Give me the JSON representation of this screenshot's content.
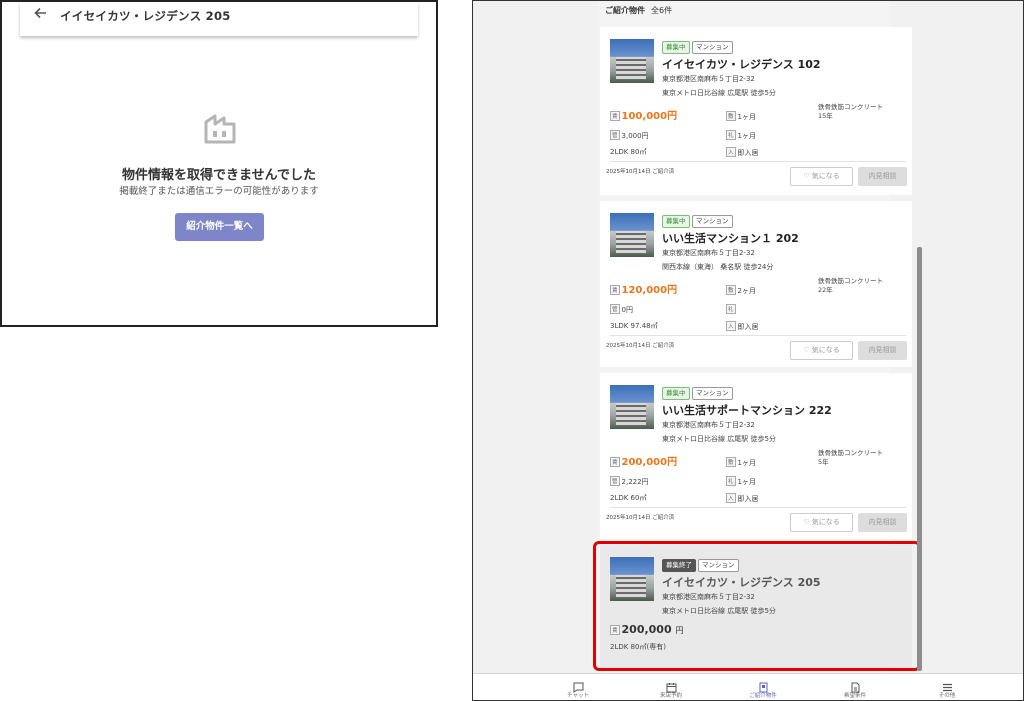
{
  "detail": {
    "title": "イイセイカツ・レジデンス 205",
    "error_title": "物件情報を取得できませんでした",
    "error_sub": "掲載終了または通信エラーの可能性があります",
    "button_label": "紹介物件一覧へ"
  },
  "list": {
    "heading": "ご紹介物件",
    "count": "全6件",
    "cards": [
      {
        "status": "募集中",
        "type": "マンション",
        "title": "イイセイカツ・レジデンス 102",
        "address": "東京都港区南麻布５丁目2-32",
        "station": "東京メトロ日比谷線 広尾駅 徒歩5分",
        "rent_tag": "賃",
        "rent": "100,000円",
        "deposit_tag": "敷",
        "deposit": "1ヶ月",
        "structure": "鉄骨鉄筋コンクリート",
        "age": "15年",
        "fee_tag": "管",
        "fee": "3,000円",
        "key_tag": "礼",
        "key": "1ヶ月",
        "layout": "2LDK 80㎡",
        "move_tag": "入",
        "move": "即入居",
        "date": "2025年10月14日 ご紹介済",
        "fav": "気になる",
        "visit": "内見相談"
      },
      {
        "status": "募集中",
        "type": "マンション",
        "title": "いい生活マンション１ 202",
        "address": "東京都港区南麻布５丁目2-32",
        "station": "関西本線（東海） 桑名駅 徒歩24分",
        "rent_tag": "賃",
        "rent": "120,000円",
        "deposit_tag": "敷",
        "deposit": "2ヶ月",
        "structure": "鉄骨鉄筋コンクリート",
        "age": "22年",
        "fee_tag": "管",
        "fee": "0円",
        "key_tag": "礼",
        "key": "",
        "layout": "3LDK 97.48㎡",
        "move_tag": "入",
        "move": "即入居",
        "date": "2025年10月14日 ご紹介済",
        "fav": "気になる",
        "visit": "内見相談"
      },
      {
        "status": "募集中",
        "type": "マンション",
        "title": "いい生活サポートマンション 222",
        "address": "東京都港区南麻布５丁目2-32",
        "station": "東京メトロ日比谷線 広尾駅 徒歩5分",
        "rent_tag": "賃",
        "rent": "200,000円",
        "deposit_tag": "敷",
        "deposit": "1ヶ月",
        "structure": "鉄骨鉄筋コンクリート",
        "age": "5年",
        "fee_tag": "管",
        "fee": "2,222円",
        "key_tag": "礼",
        "key": "1ヶ月",
        "layout": "2LDK 60㎡",
        "move_tag": "入",
        "move": "即入居",
        "date": "2025年10月14日 ご紹介済",
        "fav": "気になる",
        "visit": "内見相談"
      },
      {
        "status": "募集終了",
        "type": "マンション",
        "title": "イイセイカツ・レジデンス 205",
        "address": "東京都港区南麻布５丁目2-32",
        "station": "東京メトロ日比谷線 広尾駅 徒歩5分",
        "rent_tag": "賃",
        "rent": "200,000",
        "rent_unit": "円",
        "layout": "2LDK 80㎡(専有)"
      }
    ]
  },
  "tabs": [
    {
      "label": "チャット",
      "icon": "chat-icon"
    },
    {
      "label": "来店予約",
      "icon": "calendar-icon"
    },
    {
      "label": "ご紹介物件",
      "icon": "property-icon"
    },
    {
      "label": "希望条件",
      "icon": "document-icon"
    },
    {
      "label": "その他",
      "icon": "menu-icon"
    }
  ]
}
